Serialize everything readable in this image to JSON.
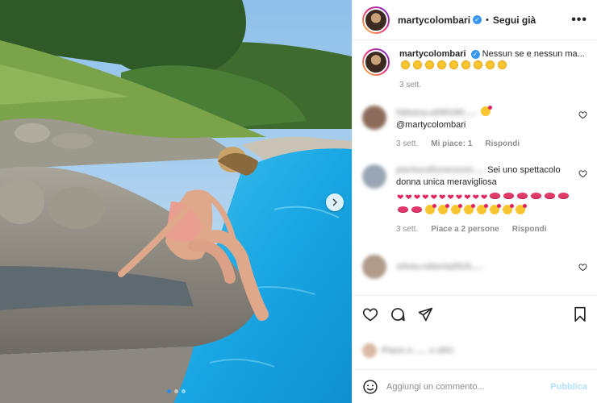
{
  "header": {
    "username": "martycolombari",
    "separator": "•",
    "follow_label": "Segui già",
    "more_label": "•••"
  },
  "caption": {
    "username": "martycolombari",
    "text": "Nessun se e nessun ma...",
    "emoji": "sun-emoji",
    "emoji_count": 9,
    "time": "3 sett."
  },
  "comments": [
    {
      "user_blurred": "fabiana.a290160.....",
      "text": "@martycolombari",
      "time": "3 sett.",
      "likes": "Mi piace: 1",
      "reply": "Rispondi"
    },
    {
      "user_blurred": "pierlucafiorenzoni.....",
      "text": "Sei uno spettacolo donna unica meravigliosa",
      "time": "3 sett.",
      "likes": "Piace a 2 persone",
      "reply": "Rispondi"
    },
    {
      "user_blurred": "silvia.roberta2015....."
    }
  ],
  "likes_blurred": "Piace a ..... e altri",
  "add_comment": {
    "placeholder": "Aggiungi un commento...",
    "publish_label": "Pubblica"
  },
  "icons": {
    "next": "chevron-right-icon",
    "like": "heart-icon",
    "comment": "comment-icon",
    "share": "send-icon",
    "save": "bookmark-icon",
    "emoji": "emoji-icon"
  },
  "colors": {
    "verified": "#3897f0",
    "publish_disabled": "#b2dffc",
    "carousel_active": "#2e8ce6"
  },
  "carousel": {
    "current": 1,
    "total": 3
  }
}
